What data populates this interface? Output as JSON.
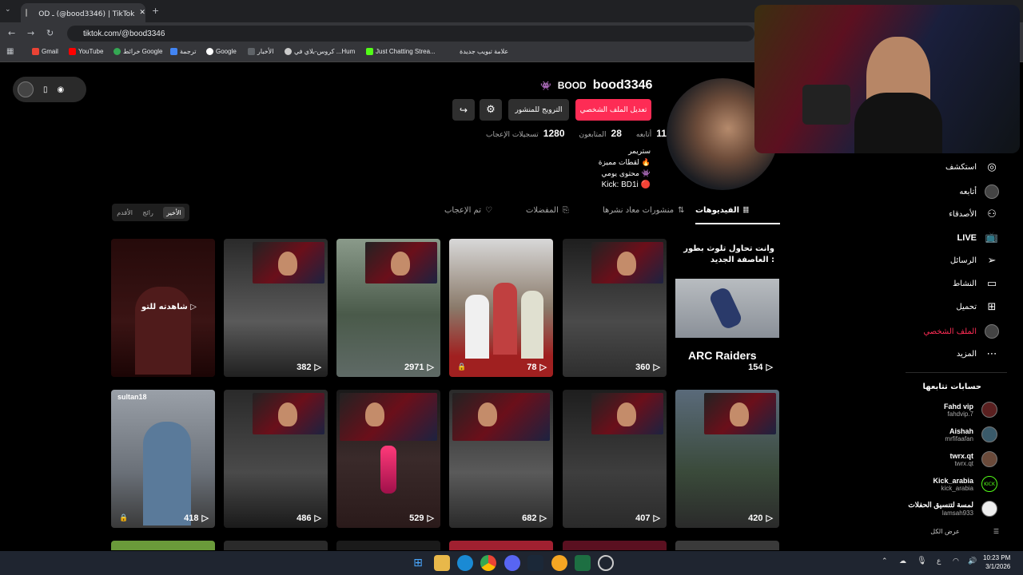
{
  "browser": {
    "tab_title": "ﾠOD ـ (@bood3346) | TikTok",
    "url": "tiktok.com/@bood3346",
    "bookmarks": [
      "Gmail",
      "YouTube",
      "خرائط Google",
      "ترجمة",
      "Google",
      "الأخبار",
      "كروس-بلاي في ...Hum",
      "Just Chatting Strea...",
      "علامة تبويب جديدة"
    ]
  },
  "profile": {
    "display_name": "BOOD",
    "username": "bood3346",
    "edit_button": "تعديل الملف الشخصي",
    "promote_button": "الترويج للمنشور",
    "following_count": "11",
    "following_label": "أتابعه",
    "followers_count": "28",
    "followers_label": "المتابعون",
    "likes_count": "1280",
    "likes_label": "تسجيلات الإعجاب",
    "bio": [
      "ستريمر",
      "لقطات مميزة 🔥",
      "محتوى يومي 👾",
      "Kick: BD1i 🔴"
    ]
  },
  "tabs": {
    "videos": "الفيديوهات",
    "reposts": "منشورات معاد نشرها",
    "favorites": "المفضلات",
    "liked": "تم الإعجاب",
    "sort": [
      "الأخير",
      "رائج",
      "الأقدم"
    ]
  },
  "videos_row1": [
    {
      "count": "",
      "overlay": "شاهدته للتو"
    },
    {
      "count": "382"
    },
    {
      "count": "2971"
    },
    {
      "count": "78"
    },
    {
      "count": "360"
    },
    {
      "count": "154",
      "caption": "وانت تحاول تلوث بطور العاصفة الجديد :",
      "brand": "ARC Raiders"
    }
  ],
  "videos_row2": [
    {
      "count": "418",
      "tag": "sultan18"
    },
    {
      "count": "486"
    },
    {
      "count": "529"
    },
    {
      "count": "682"
    },
    {
      "count": "407"
    },
    {
      "count": "420"
    }
  ],
  "sidebar": {
    "items": [
      "استكشف",
      "أتابعه",
      "الأصدقاء",
      "LIVE",
      "الرسائل",
      "النشاط",
      "تحميل",
      "الملف الشخصي",
      "المزيد"
    ],
    "following_title": "حسابات تتابعها",
    "accounts": [
      {
        "name": "Fahd vip",
        "handle": "fahdvip.7"
      },
      {
        "name": "Aishah",
        "handle": "mrfifaafan"
      },
      {
        "name": "twrx.qt",
        "handle": "twrx.qt"
      },
      {
        "name": "Kick_arabia",
        "handle": "kick_arabia"
      },
      {
        "name": "لمسة لتنسيق الحفلات",
        "handle": "lamsah933"
      }
    ],
    "see_all": "عرض الكل"
  },
  "taskbar": {
    "time": "10:23 PM",
    "date": "3/1/2026",
    "lang": "ع"
  },
  "colors": {
    "accent": "#fe2c55"
  }
}
